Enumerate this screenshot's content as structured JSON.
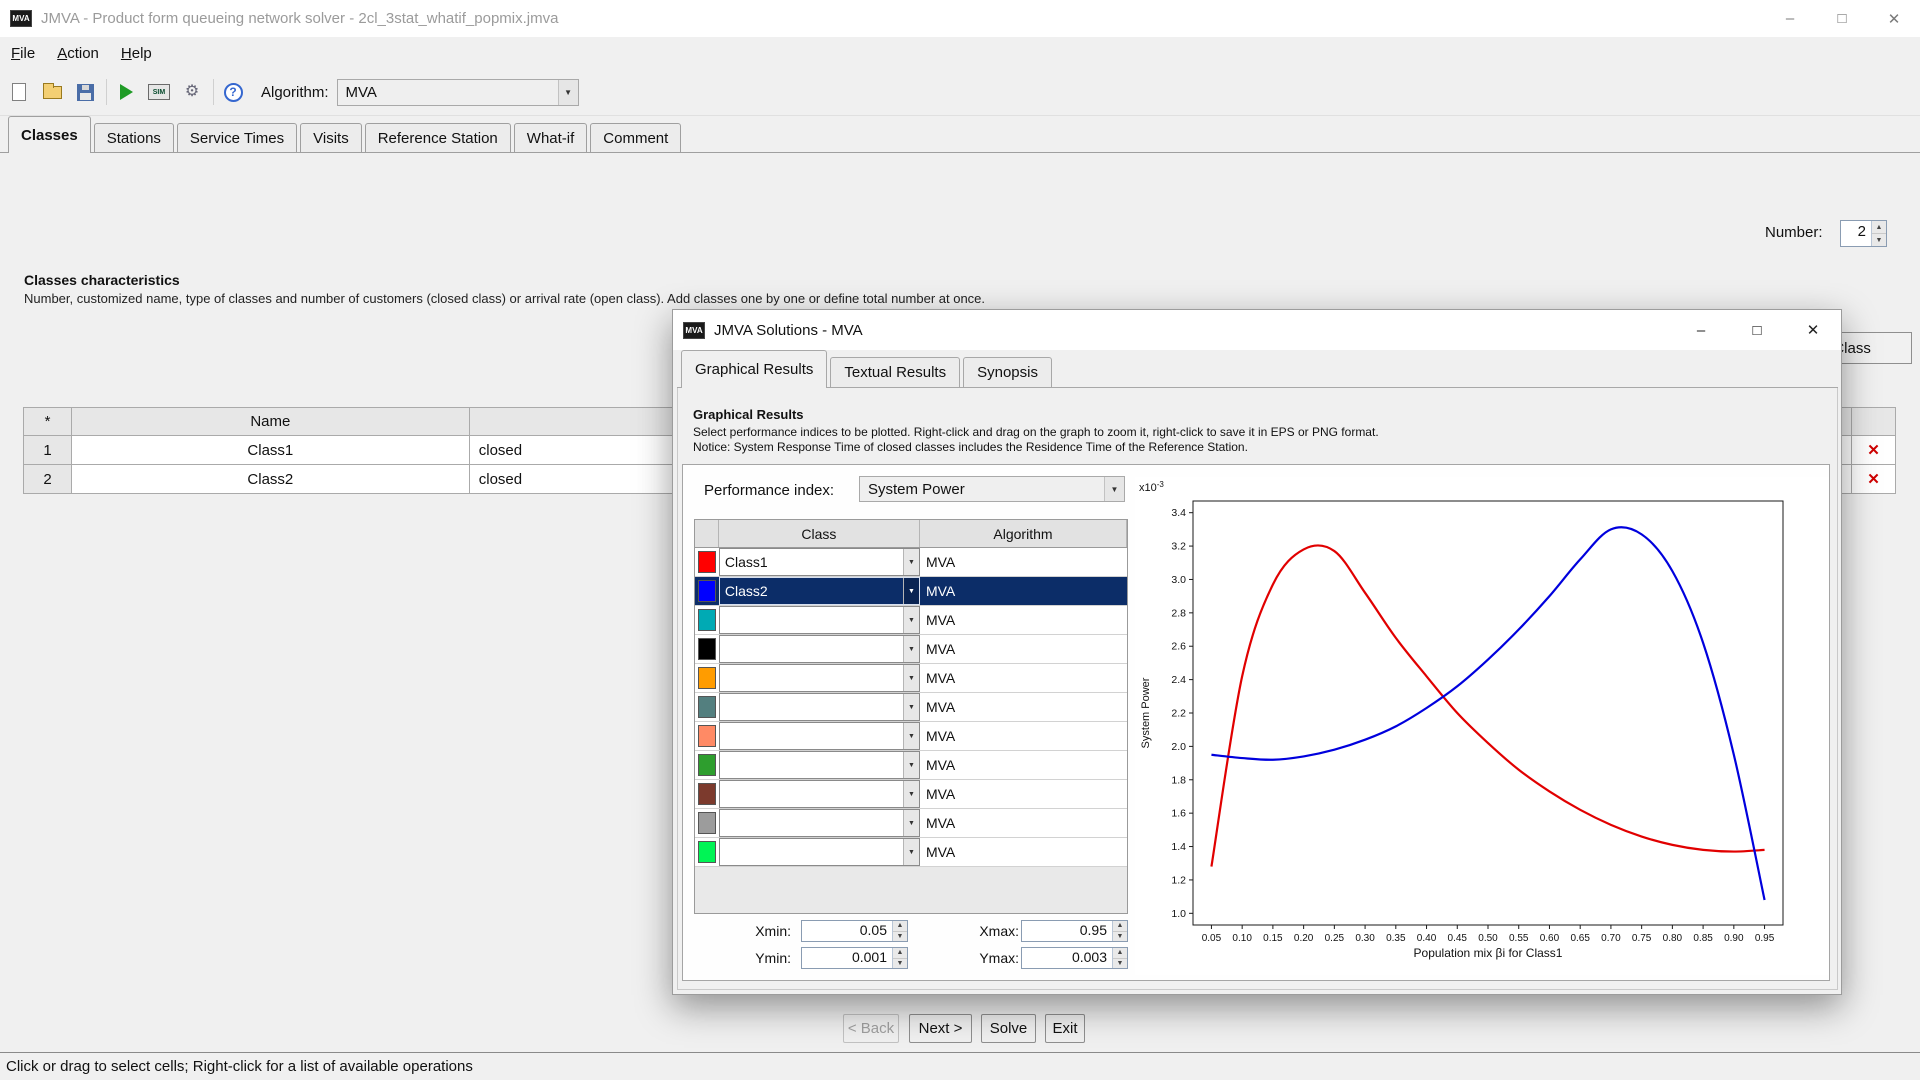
{
  "icons": {
    "minimize": "–",
    "maximize": "□",
    "close": "✕",
    "combo_arrow": "▼",
    "spin_up": "▲",
    "spin_down": "▼",
    "delete": "✕",
    "app_logo_text": "MVA",
    "sim_text": "SIM",
    "gear": "⚙",
    "help": "?"
  },
  "main_window": {
    "title": "JMVA - Product form queueing network solver - 2cl_3stat_whatif_popmix.jmva",
    "menu_items": [
      "File",
      "Action",
      "Help"
    ],
    "toolbar": {
      "algorithm_label": "Algorithm:",
      "algorithm_value": "MVA"
    },
    "tabs": [
      "Classes",
      "Stations",
      "Service Times",
      "Visits",
      "Reference Station",
      "What-if",
      "Comment"
    ],
    "number_label": "Number:",
    "number_value": "2",
    "section_heading": "Classes characteristics",
    "section_desc": "Number, customized name, type of classes and number of customers (closed class) or arrival rate (open class). Add classes one by one or define total number at once.",
    "classes_table": {
      "col_star": "*",
      "col_name": "Name",
      "rows": [
        {
          "num": "1",
          "name": "Class1",
          "type": "closed"
        },
        {
          "num": "2",
          "name": "Class2",
          "type": "closed"
        }
      ]
    },
    "new_class_button": "New Class",
    "nav_buttons": {
      "back": "< Back",
      "next": "Next >",
      "solve": "Solve",
      "exit": "Exit"
    },
    "status_bar": "Click or drag to select cells; Right-click for a list of available operations"
  },
  "dialog": {
    "title": "JMVA Solutions - MVA",
    "tabs": [
      "Graphical Results",
      "Textual Results",
      "Synopsis"
    ],
    "heading": "Graphical Results",
    "desc_line1": "Select performance indices to be plotted. Right-click and drag on the graph to zoom it, right-click to save it in EPS or PNG format.",
    "desc_line2": "Notice: System Response Time of closed classes includes the Residence Time of the Reference Station.",
    "performance_index_label": "Performance index:",
    "performance_index_value": "System Power",
    "selection_color": "#0c2d68",
    "plot_table": {
      "class_header": "Class",
      "algorithm_header": "Algorithm",
      "rows": [
        {
          "color": "#ff0000",
          "class": "Class1",
          "algorithm": "MVA",
          "selected": false
        },
        {
          "color": "#0000ff",
          "class": "Class2",
          "algorithm": "MVA",
          "selected": true
        },
        {
          "color": "#00aab4",
          "class": "",
          "algorithm": "MVA",
          "selected": false
        },
        {
          "color": "#000000",
          "class": "",
          "algorithm": "MVA",
          "selected": false
        },
        {
          "color": "#ff9c00",
          "class": "",
          "algorithm": "MVA",
          "selected": false
        },
        {
          "color": "#537f7f",
          "class": "",
          "algorithm": "MVA",
          "selected": false
        },
        {
          "color": "#ff8a65",
          "class": "",
          "algorithm": "MVA",
          "selected": false
        },
        {
          "color": "#2e9e2e",
          "class": "",
          "algorithm": "MVA",
          "selected": false
        },
        {
          "color": "#7c3a2d",
          "class": "",
          "algorithm": "MVA",
          "selected": false
        },
        {
          "color": "#9c9c9c",
          "class": "",
          "algorithm": "MVA",
          "selected": false
        },
        {
          "color": "#00f455",
          "class": "",
          "algorithm": "MVA",
          "selected": false
        }
      ]
    },
    "bounds": {
      "xmin_label": "Xmin:",
      "xmin_value": "0.05",
      "xmax_label": "Xmax:",
      "xmax_value": "0.95",
      "ymin_label": "Ymin:",
      "ymin_value": "0.001",
      "ymax_label": "Ymax:",
      "ymax_value": "0.003"
    }
  },
  "chart_data": {
    "type": "line",
    "title": "",
    "xlabel": "Population mix βi for Class1",
    "ylabel": "System Power",
    "y_scale_prefix": "x10",
    "y_scale_exp": "-3",
    "x": [
      0.05,
      0.1,
      0.15,
      0.2,
      0.25,
      0.3,
      0.35,
      0.4,
      0.45,
      0.5,
      0.55,
      0.6,
      0.65,
      0.7,
      0.75,
      0.8,
      0.85,
      0.9,
      0.95
    ],
    "series": [
      {
        "name": "Class1",
        "color": "#e10000",
        "values": [
          1.28,
          2.42,
          2.97,
          3.18,
          3.17,
          2.92,
          2.65,
          2.42,
          2.2,
          2.02,
          1.86,
          1.73,
          1.62,
          1.53,
          1.46,
          1.41,
          1.38,
          1.37,
          1.38
        ]
      },
      {
        "name": "Class2",
        "color": "#0000dd",
        "values": [
          1.95,
          1.93,
          1.92,
          1.94,
          1.98,
          2.04,
          2.12,
          2.23,
          2.36,
          2.52,
          2.7,
          2.9,
          3.12,
          3.3,
          3.27,
          3.05,
          2.62,
          1.95,
          1.08
        ]
      }
    ],
    "xticks": [
      0.05,
      0.1,
      0.15,
      0.2,
      0.25,
      0.3,
      0.35,
      0.4,
      0.45,
      0.5,
      0.55,
      0.6,
      0.65,
      0.7,
      0.75,
      0.8,
      0.85,
      0.9,
      0.95
    ],
    "yticks": [
      1.0,
      1.2,
      1.4,
      1.6,
      1.8,
      2.0,
      2.2,
      2.4,
      2.6,
      2.8,
      3.0,
      3.2,
      3.4
    ],
    "xlim": [
      0.02,
      0.98
    ],
    "ylim": [
      0.93,
      3.47
    ],
    "grid": false,
    "legend": "none"
  }
}
